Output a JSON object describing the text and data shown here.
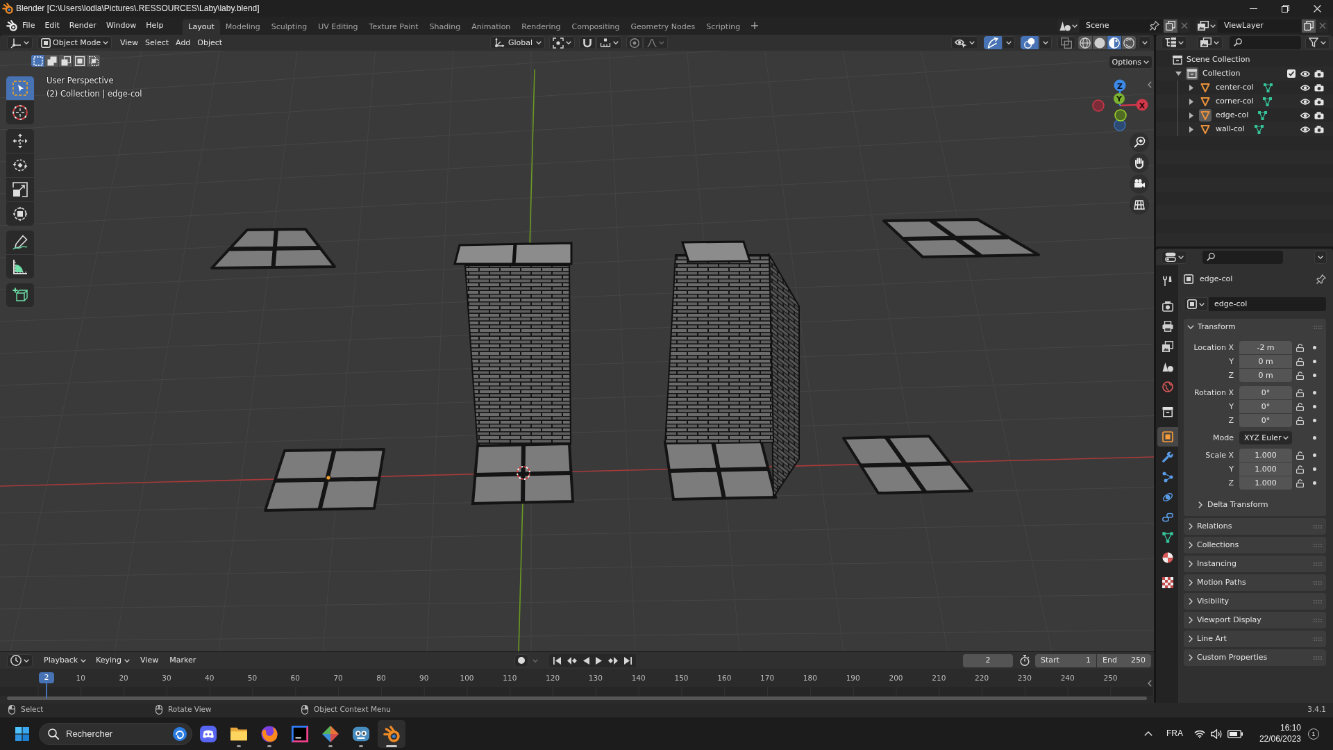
{
  "window": {
    "title": "Blender [C:\\Users\\lodla\\Pictures\\.RESSOURCES\\Laby\\laby.blend]"
  },
  "menu": [
    "File",
    "Edit",
    "Render",
    "Window",
    "Help"
  ],
  "workspace_tabs": [
    {
      "label": "Layout",
      "selected": true
    },
    {
      "label": "Modeling",
      "selected": false
    },
    {
      "label": "Sculpting",
      "selected": false
    },
    {
      "label": "UV Editing",
      "selected": false
    },
    {
      "label": "Texture Paint",
      "selected": false
    },
    {
      "label": "Shading",
      "selected": false
    },
    {
      "label": "Animation",
      "selected": false
    },
    {
      "label": "Rendering",
      "selected": false
    },
    {
      "label": "Compositing",
      "selected": false
    },
    {
      "label": "Geometry Nodes",
      "selected": false
    },
    {
      "label": "Scripting",
      "selected": false
    }
  ],
  "scene": {
    "value": "Scene"
  },
  "view_layer": {
    "value": "ViewLayer"
  },
  "viewport": {
    "header": {
      "mode": "Object Mode",
      "menus": [
        "View",
        "Select",
        "Add",
        "Object"
      ],
      "orientation": "Global",
      "toggles": [
        {
          "kind": "gizmos",
          "on": true
        },
        {
          "kind": "overlays",
          "on": true
        },
        {
          "kind": "xray",
          "on": false
        }
      ],
      "shading": [
        {
          "kind": "wireframe",
          "selected": false
        },
        {
          "kind": "solid",
          "selected": false
        },
        {
          "kind": "material",
          "selected": true
        },
        {
          "kind": "rendered",
          "selected": false
        }
      ]
    },
    "select_modes": [
      {
        "kind": "set",
        "selected": true
      },
      {
        "kind": "extend",
        "selected": false
      },
      {
        "kind": "subtract",
        "selected": false
      },
      {
        "kind": "invert",
        "selected": false
      },
      {
        "kind": "intersect",
        "selected": false
      }
    ],
    "options": "Options",
    "info": [
      "User Perspective",
      "(2) Collection | edge-col"
    ],
    "toolbar": [
      [
        {
          "kind": "select-box",
          "selected": true
        },
        {
          "kind": "cursor",
          "selected": false
        }
      ],
      [
        {
          "kind": "move",
          "selected": false
        },
        {
          "kind": "rotate",
          "selected": false
        },
        {
          "kind": "scale",
          "selected": false
        },
        {
          "kind": "transform",
          "selected": false
        }
      ],
      [
        {
          "kind": "annotate",
          "selected": false
        },
        {
          "kind": "measure",
          "selected": false
        }
      ],
      [
        {
          "kind": "add-cube",
          "selected": false
        }
      ]
    ],
    "gizmo": {
      "x": "X",
      "y": "Y",
      "z": "Z"
    }
  },
  "outliner": {
    "root": "Scene Collection",
    "collections": [
      {
        "label": "Collection",
        "expanded": true,
        "active": true,
        "checked": true,
        "children": [
          {
            "label": "center-col",
            "expanded": false,
            "selected": false
          },
          {
            "label": "corner-col",
            "expanded": false,
            "selected": false
          },
          {
            "label": "edge-col",
            "expanded": false,
            "selected": true
          },
          {
            "label": "wall-col",
            "expanded": false,
            "selected": false
          }
        ]
      }
    ]
  },
  "properties": {
    "tabs": [
      [
        {
          "kind": "tool",
          "selected": false
        }
      ],
      [
        {
          "kind": "render",
          "selected": false
        },
        {
          "kind": "output",
          "selected": false
        },
        {
          "kind": "view-layer",
          "selected": false
        },
        {
          "kind": "scene",
          "selected": false
        },
        {
          "kind": "world",
          "selected": false
        }
      ],
      [
        {
          "kind": "collection",
          "selected": false
        }
      ],
      [
        {
          "kind": "object",
          "selected": true
        },
        {
          "kind": "modifiers",
          "selected": false
        },
        {
          "kind": "particles",
          "selected": false
        },
        {
          "kind": "physics",
          "selected": false
        },
        {
          "kind": "constraints",
          "selected": false
        },
        {
          "kind": "data",
          "selected": false
        },
        {
          "kind": "material",
          "selected": false
        }
      ],
      [
        {
          "kind": "texture",
          "selected": false
        }
      ]
    ],
    "object": "edge-col",
    "name_field": "edge-col",
    "transform": {
      "title": "Transform",
      "expanded": true,
      "groups": [
        {
          "kind": "number",
          "rows": [
            {
              "label": "Location X",
              "value": "-2 m"
            },
            {
              "label": "Y",
              "value": "0 m"
            },
            {
              "label": "Z",
              "value": "0 m"
            }
          ]
        },
        {
          "kind": "number",
          "rows": [
            {
              "label": "Rotation X",
              "value": "0°"
            },
            {
              "label": "Y",
              "value": "0°"
            },
            {
              "label": "Z",
              "value": "0°"
            }
          ]
        },
        {
          "kind": "dropdown",
          "rows": [
            {
              "label": "Mode",
              "value": "XYZ Euler"
            }
          ]
        },
        {
          "kind": "number",
          "rows": [
            {
              "label": "Scale X",
              "value": "1.000"
            },
            {
              "label": "Y",
              "value": "1.000"
            },
            {
              "label": "Z",
              "value": "1.000"
            }
          ]
        }
      ],
      "subpanels": [
        {
          "label": "Delta Transform",
          "expanded": false
        }
      ]
    },
    "panels": [
      {
        "label": "Relations",
        "expanded": false
      },
      {
        "label": "Collections",
        "expanded": false
      },
      {
        "label": "Instancing",
        "expanded": false
      },
      {
        "label": "Motion Paths",
        "expanded": false
      },
      {
        "label": "Visibility",
        "expanded": false
      },
      {
        "label": "Viewport Display",
        "expanded": false
      },
      {
        "label": "Line Art",
        "expanded": false
      },
      {
        "label": "Custom Properties",
        "expanded": false
      }
    ]
  },
  "timeline": {
    "menus": [
      {
        "label": "Playback",
        "kind": "dropdown"
      },
      {
        "label": "Keying",
        "kind": "dropdown"
      },
      {
        "label": "View",
        "kind": "menu"
      },
      {
        "label": "Marker",
        "kind": "menu"
      }
    ],
    "current_frame": "2",
    "start_label": "Start",
    "start": "1",
    "end_label": "End",
    "end": "250",
    "playhead": "2",
    "ruler": [
      "10",
      "20",
      "30",
      "40",
      "50",
      "60",
      "70",
      "80",
      "90",
      "100",
      "110",
      "120",
      "130",
      "140",
      "150",
      "160",
      "170",
      "180",
      "190",
      "200",
      "210",
      "220",
      "230",
      "240",
      "250"
    ]
  },
  "status_bar": {
    "hints": [
      {
        "kind": "left-click",
        "label": "Select"
      },
      {
        "kind": "middle-click",
        "label": "Rotate View"
      },
      {
        "kind": "right-click",
        "label": "Object Context Menu"
      }
    ],
    "version": "3.4.1"
  },
  "taskbar": {
    "search": {
      "placeholder": "Rechercher"
    },
    "apps": [
      {
        "kind": "chat",
        "running": false,
        "selected": false
      },
      {
        "kind": "files",
        "running": true,
        "selected": false
      },
      {
        "kind": "browser",
        "running": true,
        "selected": false
      },
      {
        "kind": "ide",
        "running": false,
        "selected": false
      },
      {
        "kind": "git",
        "running": true,
        "selected": false
      },
      {
        "kind": "engine",
        "running": true,
        "selected": false
      },
      {
        "kind": "blender",
        "running": true,
        "selected": true
      }
    ],
    "language": "FRA",
    "time": "16:10",
    "date": "22/06/2023",
    "notifications": "1"
  }
}
